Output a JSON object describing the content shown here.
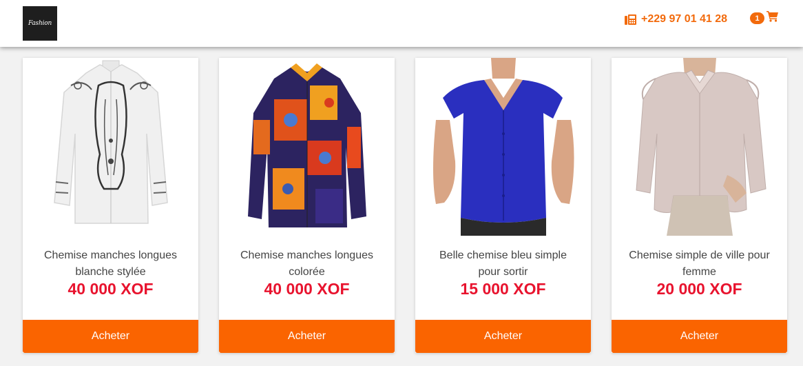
{
  "header": {
    "logo_text": "Fashion",
    "phone": "+229 97 01 41 28",
    "cart_count": "1",
    "phone_icon": "fax-icon",
    "cart_icon": "shopping-cart-icon"
  },
  "colors": {
    "accent": "#f26a0c",
    "button": "#fa6400",
    "price": "#e8132e"
  },
  "products": [
    {
      "title": "Chemise manches longues blanche stylée",
      "price": "40 000 XOF",
      "button": "Acheter",
      "image": "white-embroidered-shirt"
    },
    {
      "title": "Chemise manches longues colorée",
      "price": "40 000 XOF",
      "button": "Acheter",
      "image": "colorful-print-shirt"
    },
    {
      "title": "Belle chemise bleu simple pour sortir",
      "price": "15 000 XOF",
      "button": "Acheter",
      "image": "blue-blouse"
    },
    {
      "title": "Chemise simple de ville pour femme",
      "price": "20 000 XOF",
      "button": "Acheter",
      "image": "beige-womens-shirt"
    }
  ]
}
